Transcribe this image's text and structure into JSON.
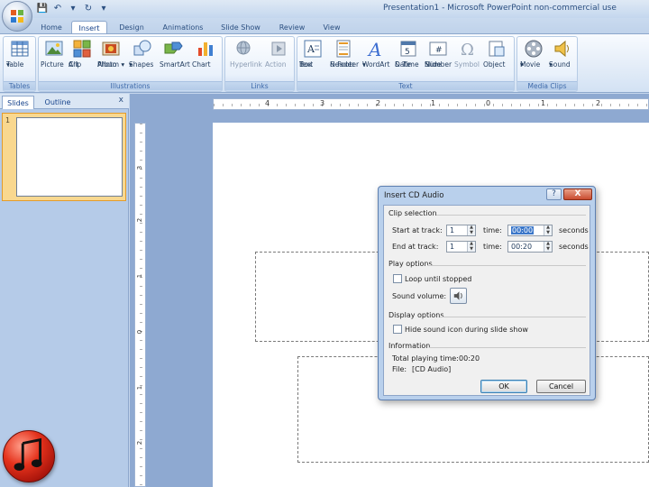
{
  "window": {
    "title": "Presentation1 - Microsoft PowerPoint non-commercial use"
  },
  "quick_access": [
    "save-icon",
    "undo-icon",
    "undo-dropdown-icon",
    "redo-icon",
    "customize-icon"
  ],
  "tabs": [
    {
      "label": "Home"
    },
    {
      "label": "Insert"
    },
    {
      "label": "Design"
    },
    {
      "label": "Animations"
    },
    {
      "label": "Slide Show"
    },
    {
      "label": "Review"
    },
    {
      "label": "View"
    }
  ],
  "ribbon": {
    "groups": {
      "tables": "Tables",
      "illustrations": "Illustrations",
      "links": "Links",
      "text": "Text",
      "media": "Media Clips"
    },
    "buttons": {
      "table": [
        "Table",
        "▾"
      ],
      "picture": [
        "Picture",
        ""
      ],
      "clipart": [
        "Clip",
        "Art"
      ],
      "photoalbum": [
        "Photo",
        "Album ▾"
      ],
      "shapes": [
        "Shapes",
        "▾"
      ],
      "smartart": [
        "SmartArt",
        ""
      ],
      "chart": [
        "Chart",
        ""
      ],
      "hyperlink": [
        "Hyperlink",
        ""
      ],
      "action": [
        "Action",
        ""
      ],
      "textbox": [
        "Text",
        "Box"
      ],
      "headerfooter": [
        "Header",
        "& Footer"
      ],
      "wordart": [
        "WordArt",
        "▾"
      ],
      "datetime": [
        "Date",
        "& Time"
      ],
      "slidenumber": [
        "Slide",
        "Number"
      ],
      "symbol": [
        "Symbol",
        ""
      ],
      "object": [
        "Object",
        ""
      ],
      "movie": [
        "Movie",
        "▾"
      ],
      "sound": [
        "Sound",
        "▾"
      ]
    }
  },
  "left_pane": {
    "tabs": [
      "Slides",
      "Outline"
    ],
    "close": "x",
    "slide_number": "1"
  },
  "ruler": {
    "h_numbers": [
      "4",
      "3",
      "2",
      "1",
      "0",
      "1",
      "2"
    ],
    "v_numbers": [
      "3",
      "2",
      "1",
      "0",
      "1",
      "2"
    ]
  },
  "dialog": {
    "title": "Insert CD Audio",
    "help": "?",
    "close": "X",
    "clip_selection": {
      "section": "Clip selection",
      "start_label": "Start at track:",
      "start_track": "1",
      "start_time_label": "time:",
      "start_time": "00:00",
      "start_unit": "seconds",
      "end_label": "End at track:",
      "end_track": "1",
      "end_time_label": "time:",
      "end_time": "00:20",
      "end_unit": "seconds"
    },
    "play_options": {
      "section": "Play options",
      "loop_label": "Loop until stopped",
      "loop_checked": false,
      "volume_label": "Sound volume:"
    },
    "display_options": {
      "section": "Display options",
      "hide_label": "Hide sound icon during slide show",
      "hide_checked": false
    },
    "information": {
      "section": "Information",
      "total_label": "Total playing time:",
      "total_value": "00:20",
      "file_label": "File:",
      "file_value": "[CD Audio]"
    },
    "ok": "OK",
    "cancel": "Cancel"
  },
  "colors": {
    "ribbon_text": "#1e395b",
    "group_label": "#3e6aaa",
    "selection_orange": "#f9d88f",
    "close_red": "#c84b2f",
    "music_icon_red": "#e5321c"
  }
}
